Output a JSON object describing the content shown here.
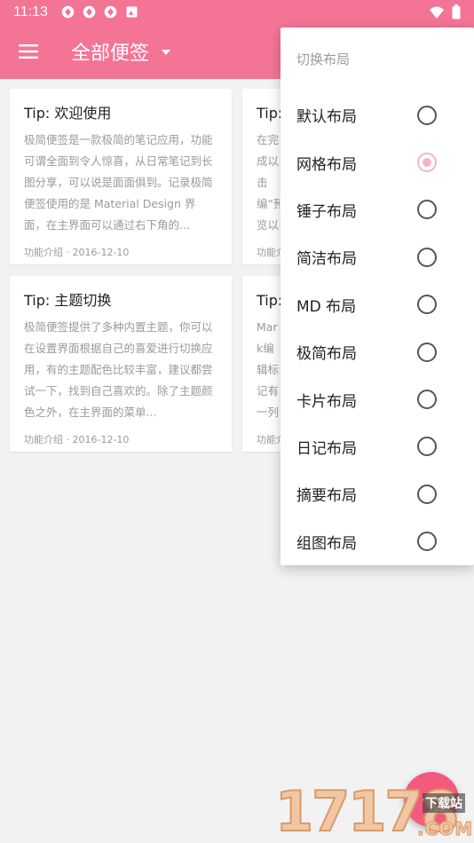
{
  "status_bar": {
    "time": "11:13",
    "notification_icons": [
      "sync-icon",
      "sync-icon",
      "sync-icon",
      "image-icon"
    ],
    "wifi_icon": "wifi-icon",
    "battery_icon": "battery-icon"
  },
  "app_bar": {
    "menu_icon": "menu-icon",
    "title": "全部便签",
    "dropdown_icon": "caret-down-icon",
    "color": "#f47496"
  },
  "notes": [
    {
      "title": "Tip: 欢迎使用",
      "body": "极简便签是一款极简的笔记应用，功能可谓全面到令人惊喜，从日常笔记到长图分享，可以说是面面俱到。记录极简便签使用的是 Material Design 界面，在主界面可以通过右下角的...",
      "meta": "功能介绍 · 2016-12-10"
    },
    {
      "title": "Tip:",
      "body": "在完成以击编“预览以定",
      "meta": "功能介"
    },
    {
      "title": "Tip: 主题切换",
      "body": "极简便签提供了多种内置主题，你可以在设置界面根据自己的喜爱进行切换应用，有的主题配色比较丰富，建议都尝试一下，找到自己喜欢的。除了主题颜色之外，在主界面的菜单...",
      "meta": "功能介绍 · 2016-12-10"
    },
    {
      "title": "Tip:",
      "body": "Mark编辑标记有一列表",
      "meta": "功能介"
    }
  ],
  "layout_menu": {
    "header": "切换布局",
    "options": [
      {
        "label": "默认布局",
        "checked": false
      },
      {
        "label": "网格布局",
        "checked": true
      },
      {
        "label": "锤子布局",
        "checked": false
      },
      {
        "label": "简洁布局",
        "checked": false
      },
      {
        "label": "MD 布局",
        "checked": false
      },
      {
        "label": "极简布局",
        "checked": false
      },
      {
        "label": "卡片布局",
        "checked": false
      },
      {
        "label": "日记布局",
        "checked": false
      },
      {
        "label": "摘要布局",
        "checked": false
      },
      {
        "label": "组图布局",
        "checked": false
      }
    ]
  },
  "fab": {
    "icon": "add-icon",
    "color": "#f25b7c"
  },
  "watermark": {
    "number": "17178",
    "site": "下载站",
    "domain": ".COM"
  }
}
